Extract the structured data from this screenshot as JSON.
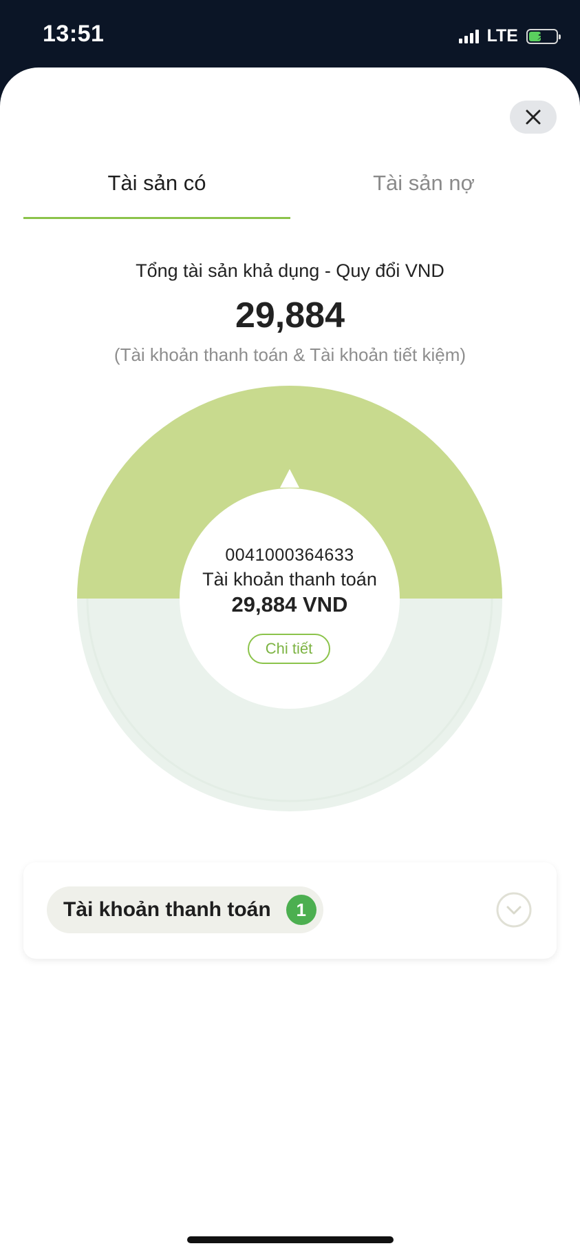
{
  "status_bar": {
    "time": "13:51",
    "network": "LTE",
    "battery_level": 0.45
  },
  "tabs": {
    "assets_label": "Tài sản có",
    "liabilities_label": "Tài sản nợ"
  },
  "summary": {
    "label": "Tổng tài sản khả dụng - Quy đổi VND",
    "total": "29,884",
    "note": "(Tài khoản thanh toán & Tài khoản tiết kiệm)"
  },
  "donut": {
    "account_number": "0041000364633",
    "account_type": "Tài khoản thanh toán",
    "balance": "29,884 VND",
    "detail_label": "Chi tiết"
  },
  "account_card": {
    "label": "Tài khoản thanh toán",
    "count": "1"
  },
  "colors": {
    "accent": "#8bc34a",
    "donut_fill": "#c8da8e",
    "donut_track": "#eaf2ec",
    "badge": "#4caf50"
  }
}
